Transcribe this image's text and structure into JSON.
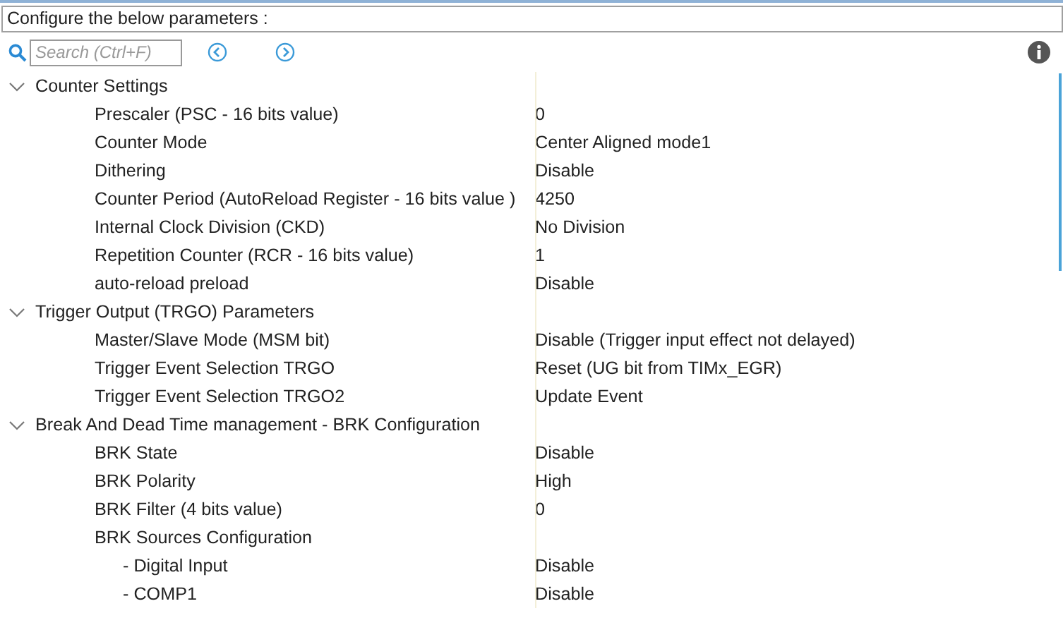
{
  "header": {
    "title": "Configure the below parameters :"
  },
  "search": {
    "placeholder": "Search (Ctrl+F)"
  },
  "groups": [
    {
      "label": "Counter Settings",
      "expanded": true,
      "params": [
        {
          "label": "Prescaler (PSC - 16 bits value)",
          "value": "0"
        },
        {
          "label": "Counter Mode",
          "value": "Center Aligned mode1"
        },
        {
          "label": "Dithering",
          "value": "Disable"
        },
        {
          "label": "Counter Period (AutoReload Register - 16 bits value )",
          "value": "4250"
        },
        {
          "label": "Internal Clock Division (CKD)",
          "value": "No Division"
        },
        {
          "label": "Repetition Counter (RCR - 16 bits value)",
          "value": "1"
        },
        {
          "label": "auto-reload preload",
          "value": "Disable"
        }
      ]
    },
    {
      "label": "Trigger Output (TRGO) Parameters",
      "expanded": true,
      "params": [
        {
          "label": "Master/Slave Mode (MSM bit)",
          "value": "Disable (Trigger input effect not delayed)"
        },
        {
          "label": "Trigger Event Selection TRGO",
          "value": "Reset (UG bit from TIMx_EGR)"
        },
        {
          "label": "Trigger Event Selection TRGO2",
          "value": "Update Event"
        }
      ]
    },
    {
      "label": "Break And Dead Time management - BRK Configuration",
      "expanded": true,
      "params": [
        {
          "label": "BRK State",
          "value": "Disable"
        },
        {
          "label": "BRK Polarity",
          "value": "High"
        },
        {
          "label": "BRK Filter (4 bits value)",
          "value": "0"
        },
        {
          "label": "BRK Sources Configuration",
          "children": [
            {
              "label": "- Digital Input",
              "value": "Disable"
            },
            {
              "label": "- COMP1",
              "value": "Disable"
            }
          ]
        }
      ]
    }
  ]
}
